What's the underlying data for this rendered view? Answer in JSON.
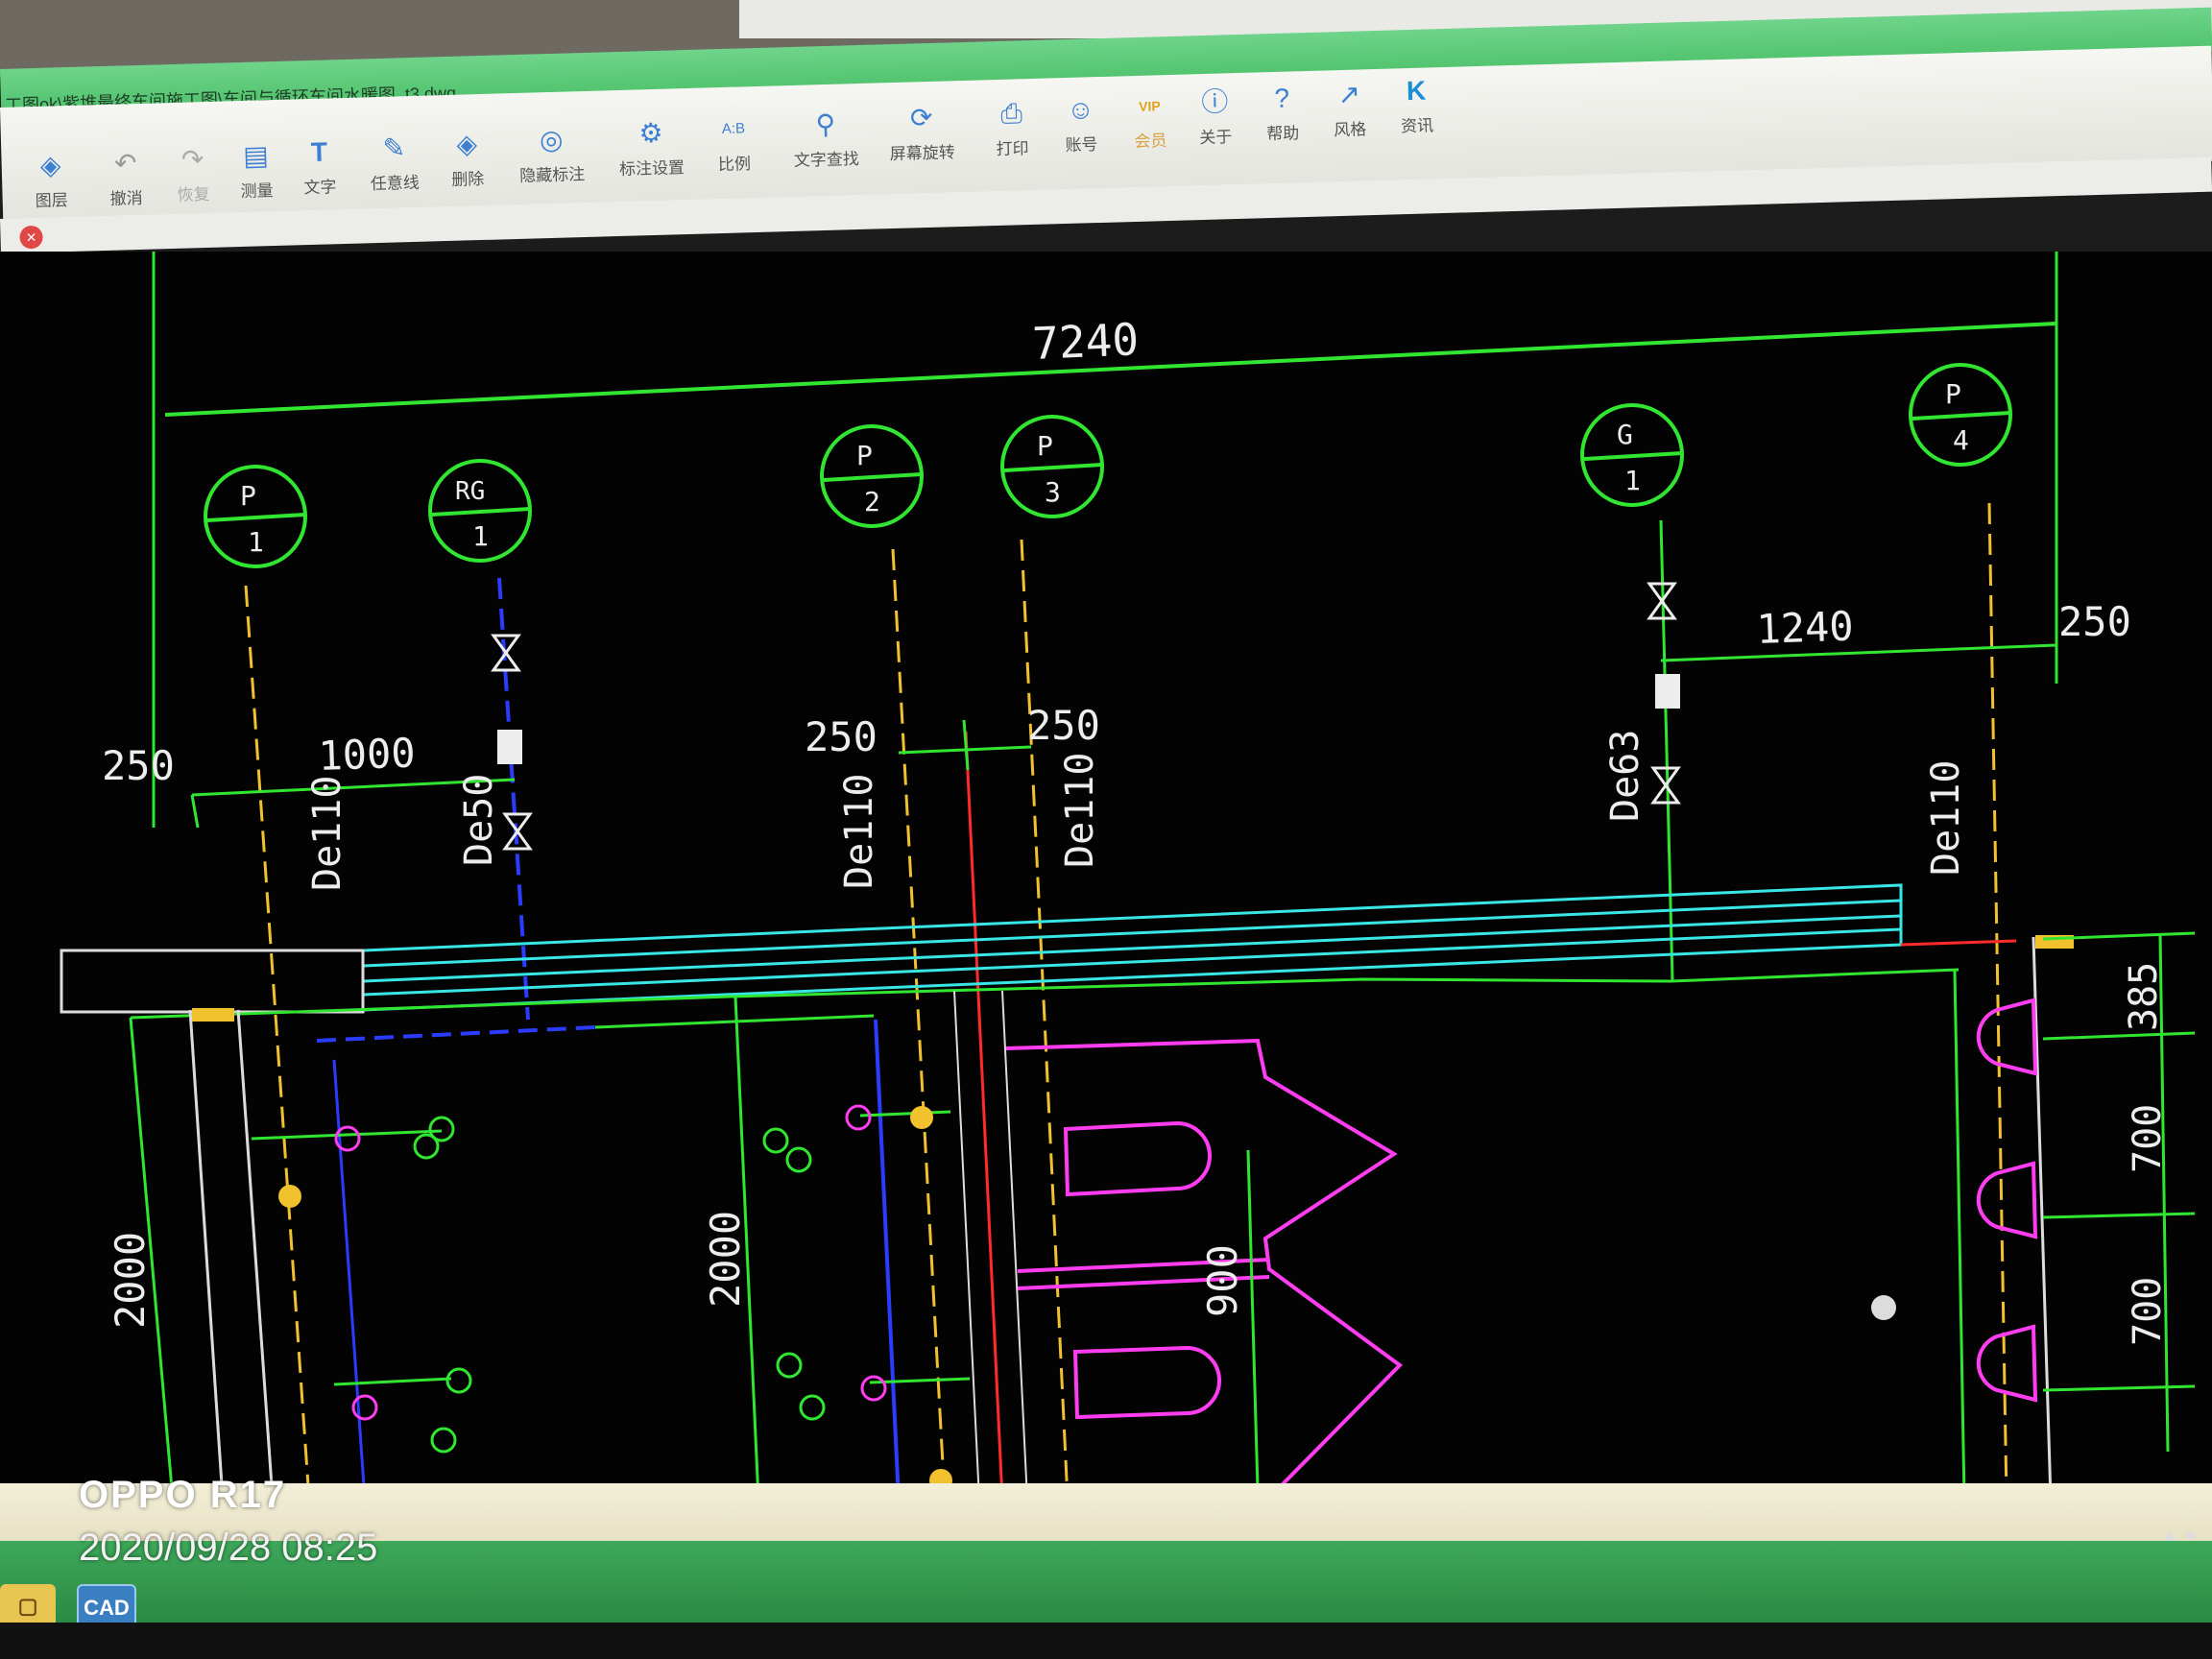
{
  "window": {
    "title": "工图ok\\紫堆最终车间施工图\\车间与循环车间水暖图_t3.dwg"
  },
  "toolbar": {
    "items": [
      {
        "label": "图层",
        "icon": "layers-icon"
      },
      {
        "label": "撤消",
        "icon": "undo-icon"
      },
      {
        "label": "恢复",
        "icon": "redo-icon"
      },
      {
        "label": "测量",
        "icon": "measure-icon"
      },
      {
        "label": "文字",
        "icon": "text-icon"
      },
      {
        "label": "任意线",
        "icon": "pencil-icon"
      },
      {
        "label": "删除",
        "icon": "eraser-icon"
      },
      {
        "label": "隐藏标注",
        "icon": "eye-icon"
      },
      {
        "label": "标注设置",
        "icon": "annotation-settings-icon"
      },
      {
        "label": "比例",
        "icon": "scale-icon"
      },
      {
        "label": "文字查找",
        "icon": "text-search-icon"
      },
      {
        "label": "屏幕旋转",
        "icon": "rotate-screen-icon"
      },
      {
        "label": "打印",
        "icon": "printer-icon"
      },
      {
        "label": "账号",
        "icon": "user-icon"
      },
      {
        "label": "会员",
        "icon": "vip-icon"
      },
      {
        "label": "关于",
        "icon": "info-icon"
      },
      {
        "label": "帮助",
        "icon": "help-icon"
      },
      {
        "label": "风格",
        "icon": "style-icon"
      },
      {
        "label": "资讯",
        "icon": "news-icon"
      }
    ],
    "vip_badge": "VIP",
    "scale_glyph": "A:B"
  },
  "drawing": {
    "dim_overall": "7240",
    "dim_left_offset": "250",
    "dim_left_span": "1000",
    "dim_mid_left": "250",
    "dim_mid_right": "250",
    "dim_right_span": "1240",
    "dim_right_offset": "250",
    "dim_vertical_385": "385",
    "dim_vertical_700a": "700",
    "dim_vertical_700b": "700",
    "dim_vertical_2000_left": "2000",
    "dim_vertical_2000_mid": "2000",
    "dim_vertical_900": "900",
    "pipe_p1": "De110",
    "pipe_rg1": "De50",
    "pipe_p2": "De110",
    "pipe_p3": "De110",
    "pipe_g1": "De63",
    "pipe_p4": "De110",
    "markers": [
      {
        "top": "P",
        "bottom": "1"
      },
      {
        "top": "RG",
        "bottom": "1"
      },
      {
        "top": "P",
        "bottom": "2"
      },
      {
        "top": "P",
        "bottom": "3"
      },
      {
        "top": "G",
        "bottom": "1"
      },
      {
        "top": "P",
        "bottom": "4"
      }
    ]
  },
  "taskbar": {
    "cad_label": "CAD"
  },
  "watermark": {
    "brand": "OPPO R17",
    "timestamp": "2020/09/28 08:25"
  },
  "colors": {
    "dimension": "#31e631",
    "drain_pipe": "#f2c12e",
    "hot_pipe": "#2b3cff",
    "fixture": "#ff3df0",
    "beam": "#38e6e6",
    "wall": "#dcdcdc",
    "red_axis": "#ff2a2a"
  }
}
